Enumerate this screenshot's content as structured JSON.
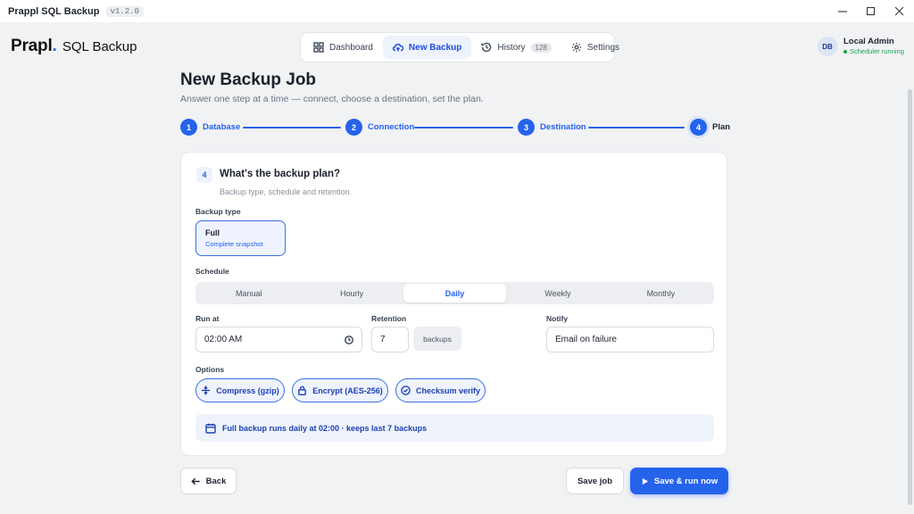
{
  "window": {
    "app_title": "Prappl SQL Backup",
    "version": "v1.2.0"
  },
  "brand": {
    "name": "Prapl",
    "dot": ".",
    "product": "SQL Backup"
  },
  "nav": {
    "items": [
      {
        "label": "Dashboard",
        "icon": "dashboard-icon"
      },
      {
        "label": "New Backup",
        "icon": "cloud-upload-icon",
        "active": true
      },
      {
        "label": "History",
        "icon": "history-icon",
        "count": "128"
      },
      {
        "label": "Settings",
        "icon": "gear-icon"
      }
    ]
  },
  "user": {
    "initials": "DB",
    "name": "Local Admin",
    "status": "Scheduler running",
    "status_color": "#16a34a"
  },
  "page": {
    "title": "New Backup Job",
    "subtitle": "Answer one step at a time — connect, choose a destination, set the plan."
  },
  "stepper": {
    "steps": [
      {
        "num": "1",
        "label": "Database"
      },
      {
        "num": "2",
        "label": "Connection"
      },
      {
        "num": "3",
        "label": "Destination"
      },
      {
        "num": "4",
        "label": "Plan",
        "current": true
      }
    ]
  },
  "card": {
    "badge": "4",
    "title": "What's the backup plan?",
    "subtitle": "Backup type, schedule and retention.",
    "backup_type": {
      "label": "Backup type",
      "name": "Full",
      "desc": "Complete snapshot"
    },
    "schedule": {
      "label": "Schedule",
      "options": [
        "Manual",
        "Hourly",
        "Daily",
        "Weekly",
        "Monthly"
      ],
      "selected": "Daily"
    },
    "run_at": {
      "label": "Run at",
      "value": "02:00 AM"
    },
    "retention": {
      "label": "Retention",
      "value": "7",
      "unit": "backups"
    },
    "notify": {
      "label": "Notify",
      "value": "Email on failure"
    },
    "options": {
      "label": "Options",
      "items": [
        {
          "label": "Compress (gzip)",
          "icon": "compress-icon"
        },
        {
          "label": "Encrypt (AES-256)",
          "icon": "lock-icon"
        },
        {
          "label": "Checksum verify",
          "icon": "check-circle-icon"
        }
      ]
    },
    "summary": "Full backup runs daily at 02:00 · keeps last 7 backups"
  },
  "footer": {
    "back": "Back",
    "save": "Save job",
    "run": "Save & run now"
  },
  "colors": {
    "accent": "#2563eb",
    "background": "#f1f2f4"
  }
}
